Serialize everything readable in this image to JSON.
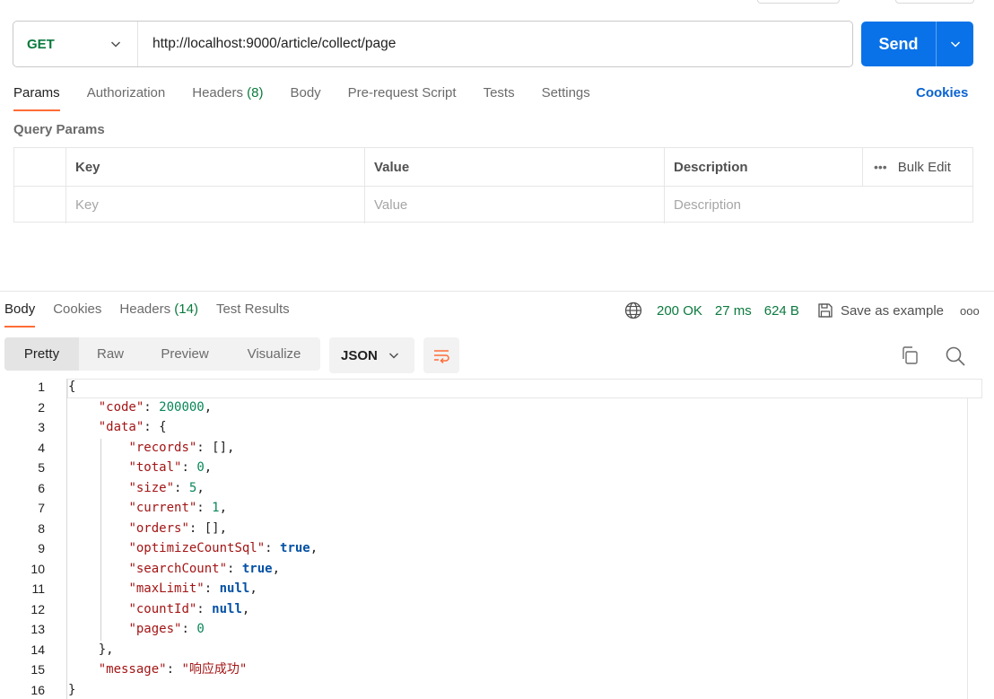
{
  "request": {
    "method": "GET",
    "url": "http://localhost:9000/article/collect/page",
    "send_label": "Send"
  },
  "request_tabs": {
    "params": "Params",
    "authorization": "Authorization",
    "headers": "Headers",
    "headers_count": "(8)",
    "body": "Body",
    "pre_request": "Pre-request Script",
    "tests": "Tests",
    "settings": "Settings",
    "cookies": "Cookies"
  },
  "query_params": {
    "title": "Query Params",
    "columns": {
      "key": "Key",
      "value": "Value",
      "description": "Description"
    },
    "bulk_edit": "Bulk Edit",
    "placeholders": {
      "key": "Key",
      "value": "Value",
      "description": "Description"
    }
  },
  "response_tabs": {
    "body": "Body",
    "cookies": "Cookies",
    "headers": "Headers",
    "headers_count": "(14)",
    "test_results": "Test Results"
  },
  "response_status": {
    "status": "200 OK",
    "time": "27 ms",
    "size": "624 B",
    "save_example": "Save as example"
  },
  "view_modes": {
    "pretty": "Pretty",
    "raw": "Raw",
    "preview": "Preview",
    "visualize": "Visualize"
  },
  "format": "JSON",
  "colors": {
    "accent": "#ff6c37",
    "send": "#0a72e8",
    "method": "#0b7a3e",
    "link": "#0a63d1"
  },
  "icons": [
    "chevron-down-icon",
    "globe-icon",
    "save-icon",
    "more-icon",
    "wrap-lines-icon",
    "copy-icon",
    "search-icon"
  ],
  "code": {
    "line_numbers": [
      "1",
      "2",
      "3",
      "4",
      "5",
      "6",
      "7",
      "8",
      "9",
      "10",
      "11",
      "12",
      "13",
      "14",
      "15",
      "16"
    ],
    "keys": {
      "code": "\"code\"",
      "data": "\"data\"",
      "records": "\"records\"",
      "total": "\"total\"",
      "size": "\"size\"",
      "current": "\"current\"",
      "orders": "\"orders\"",
      "optimizeCountSql": "\"optimizeCountSql\"",
      "searchCount": "\"searchCount\"",
      "maxLimit": "\"maxLimit\"",
      "countId": "\"countId\"",
      "pages": "\"pages\"",
      "message": "\"message\""
    },
    "values": {
      "code": "200000",
      "records": "[]",
      "total": "0",
      "size": "5",
      "current": "1",
      "orders": "[]",
      "optimizeCountSql": "true",
      "searchCount": "true",
      "maxLimit": "null",
      "countId": "null",
      "pages": "0",
      "message": "\"响应成功\""
    }
  }
}
